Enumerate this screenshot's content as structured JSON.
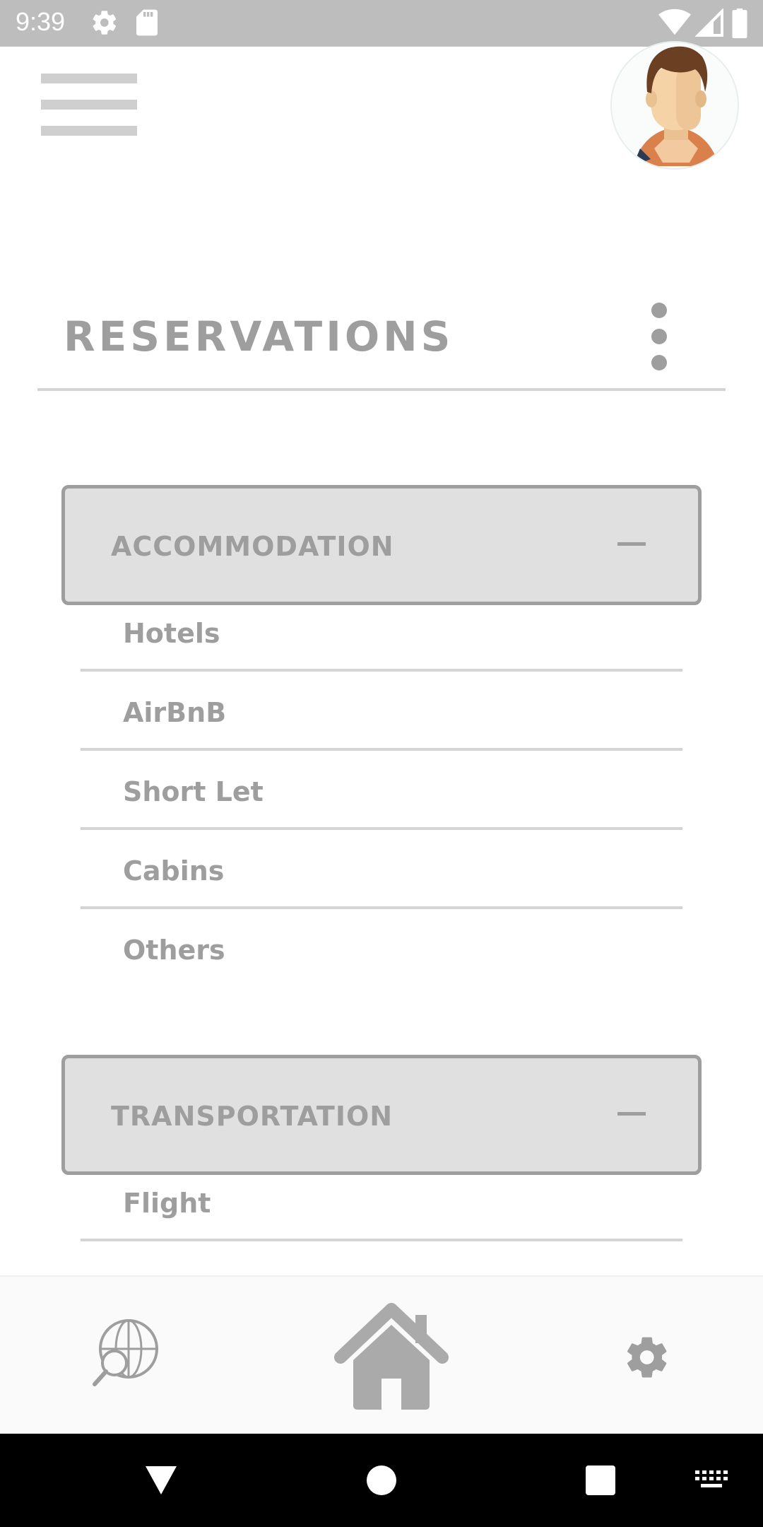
{
  "status_bar": {
    "time": "9:39",
    "icons": [
      "gear-icon",
      "sd-card-icon",
      "wifi-icon",
      "signal-icon",
      "battery-icon"
    ]
  },
  "header": {
    "menu_icon": "hamburger-menu-icon",
    "avatar": "user-avatar",
    "title": "RESERVATIONS",
    "more_icon": "more-vertical-icon"
  },
  "sections": [
    {
      "label": "ACCOMMODATION",
      "toggle_icon": "collapse-minus-icon",
      "items": [
        "Hotels",
        "AirBnB",
        "Short Let",
        "Cabins",
        "Others"
      ]
    },
    {
      "label": "TRANSPORTATION",
      "toggle_icon": "collapse-minus-icon",
      "items": [
        "Flight"
      ]
    }
  ],
  "bottom_nav": {
    "items": [
      "globe-search-icon",
      "home-icon",
      "settings-gear-icon"
    ]
  },
  "system_nav": {
    "items": [
      "back-icon",
      "home-circle-icon",
      "recents-icon",
      "keyboard-icon"
    ]
  },
  "colors": {
    "status_bar": "#bdbdbd",
    "text_gray": "#9e9e9e",
    "section_bg": "#e0e0e0",
    "divider": "#d4d4d4",
    "system_nav": "#000000"
  }
}
